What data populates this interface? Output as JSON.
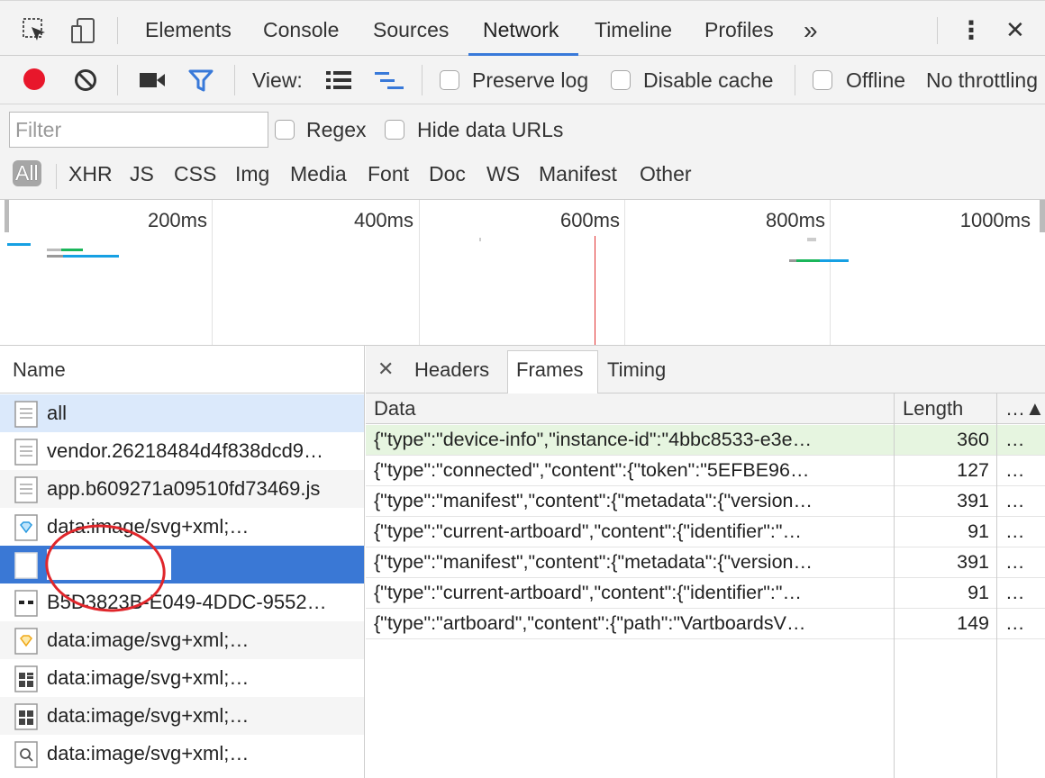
{
  "tabs": {
    "items": [
      {
        "label": "Elements"
      },
      {
        "label": "Console"
      },
      {
        "label": "Sources"
      },
      {
        "label": "Network"
      },
      {
        "label": "Timeline"
      },
      {
        "label": "Profiles"
      }
    ],
    "overflow": "»",
    "menu": "⋮",
    "close": "✕"
  },
  "toolbar": {
    "view_label": "View:",
    "preserve_log": "Preserve log",
    "disable_cache": "Disable cache",
    "offline": "Offline",
    "throttling": "No throttling"
  },
  "filter": {
    "placeholder": "Filter",
    "regex": "Regex",
    "hide_data_urls": "Hide data URLs"
  },
  "types": [
    "All",
    "XHR",
    "JS",
    "CSS",
    "Img",
    "Media",
    "Font",
    "Doc",
    "WS",
    "Manifest",
    "Other"
  ],
  "overview": {
    "labels": [
      "200ms",
      "400ms",
      "600ms",
      "800ms",
      "1000ms"
    ]
  },
  "requests": {
    "header": "Name",
    "items": [
      {
        "name": "all",
        "icon": "document-icon"
      },
      {
        "name": "vendor.26218484d4f838dcd9…",
        "icon": "document-icon"
      },
      {
        "name": "app.b609271a09510fd73469.js",
        "icon": "document-icon"
      },
      {
        "name": "data:image/svg+xml;…",
        "icon": "diamond-blue-icon"
      },
      {
        "name": "",
        "icon": "blank-document-icon"
      },
      {
        "name": "B5D3823B-E049-4DDC-9552…",
        "icon": "image-icon"
      },
      {
        "name": "data:image/svg+xml;…",
        "icon": "diamond-yellow-icon"
      },
      {
        "name": "data:image/svg+xml;…",
        "icon": "grid-icon"
      },
      {
        "name": "data:image/svg+xml;…",
        "icon": "grid-icon"
      },
      {
        "name": "data:image/svg+xml;…",
        "icon": "search-icon"
      }
    ]
  },
  "detail": {
    "close": "✕",
    "tabs": [
      "Headers",
      "Frames",
      "Timing"
    ],
    "columns": {
      "data": "Data",
      "length": "Length",
      "more": "…▲"
    },
    "frames": [
      {
        "data": "{\"type\":\"device-info\",\"instance-id\":\"4bbc8533-e3e…",
        "length": "360",
        "more": "…"
      },
      {
        "data": "{\"type\":\"connected\",\"content\":{\"token\":\"5EFBE96…",
        "length": "127",
        "more": "…"
      },
      {
        "data": "{\"type\":\"manifest\",\"content\":{\"metadata\":{\"version…",
        "length": "391",
        "more": "…"
      },
      {
        "data": "{\"type\":\"current-artboard\",\"content\":{\"identifier\":\"…",
        "length": "91",
        "more": "…"
      },
      {
        "data": "{\"type\":\"manifest\",\"content\":{\"metadata\":{\"version…",
        "length": "391",
        "more": "…"
      },
      {
        "data": "{\"type\":\"current-artboard\",\"content\":{\"identifier\":\"…",
        "length": "91",
        "more": "…"
      },
      {
        "data": "{\"type\":\"artboard\",\"content\":{\"path\":\"VartboardsV…",
        "length": "149",
        "more": "…"
      }
    ]
  },
  "colors": {
    "accent": "#3879d9",
    "record": "#e8172b",
    "selected_row": "#3a78d5",
    "success_row": "#e6f5e0"
  }
}
